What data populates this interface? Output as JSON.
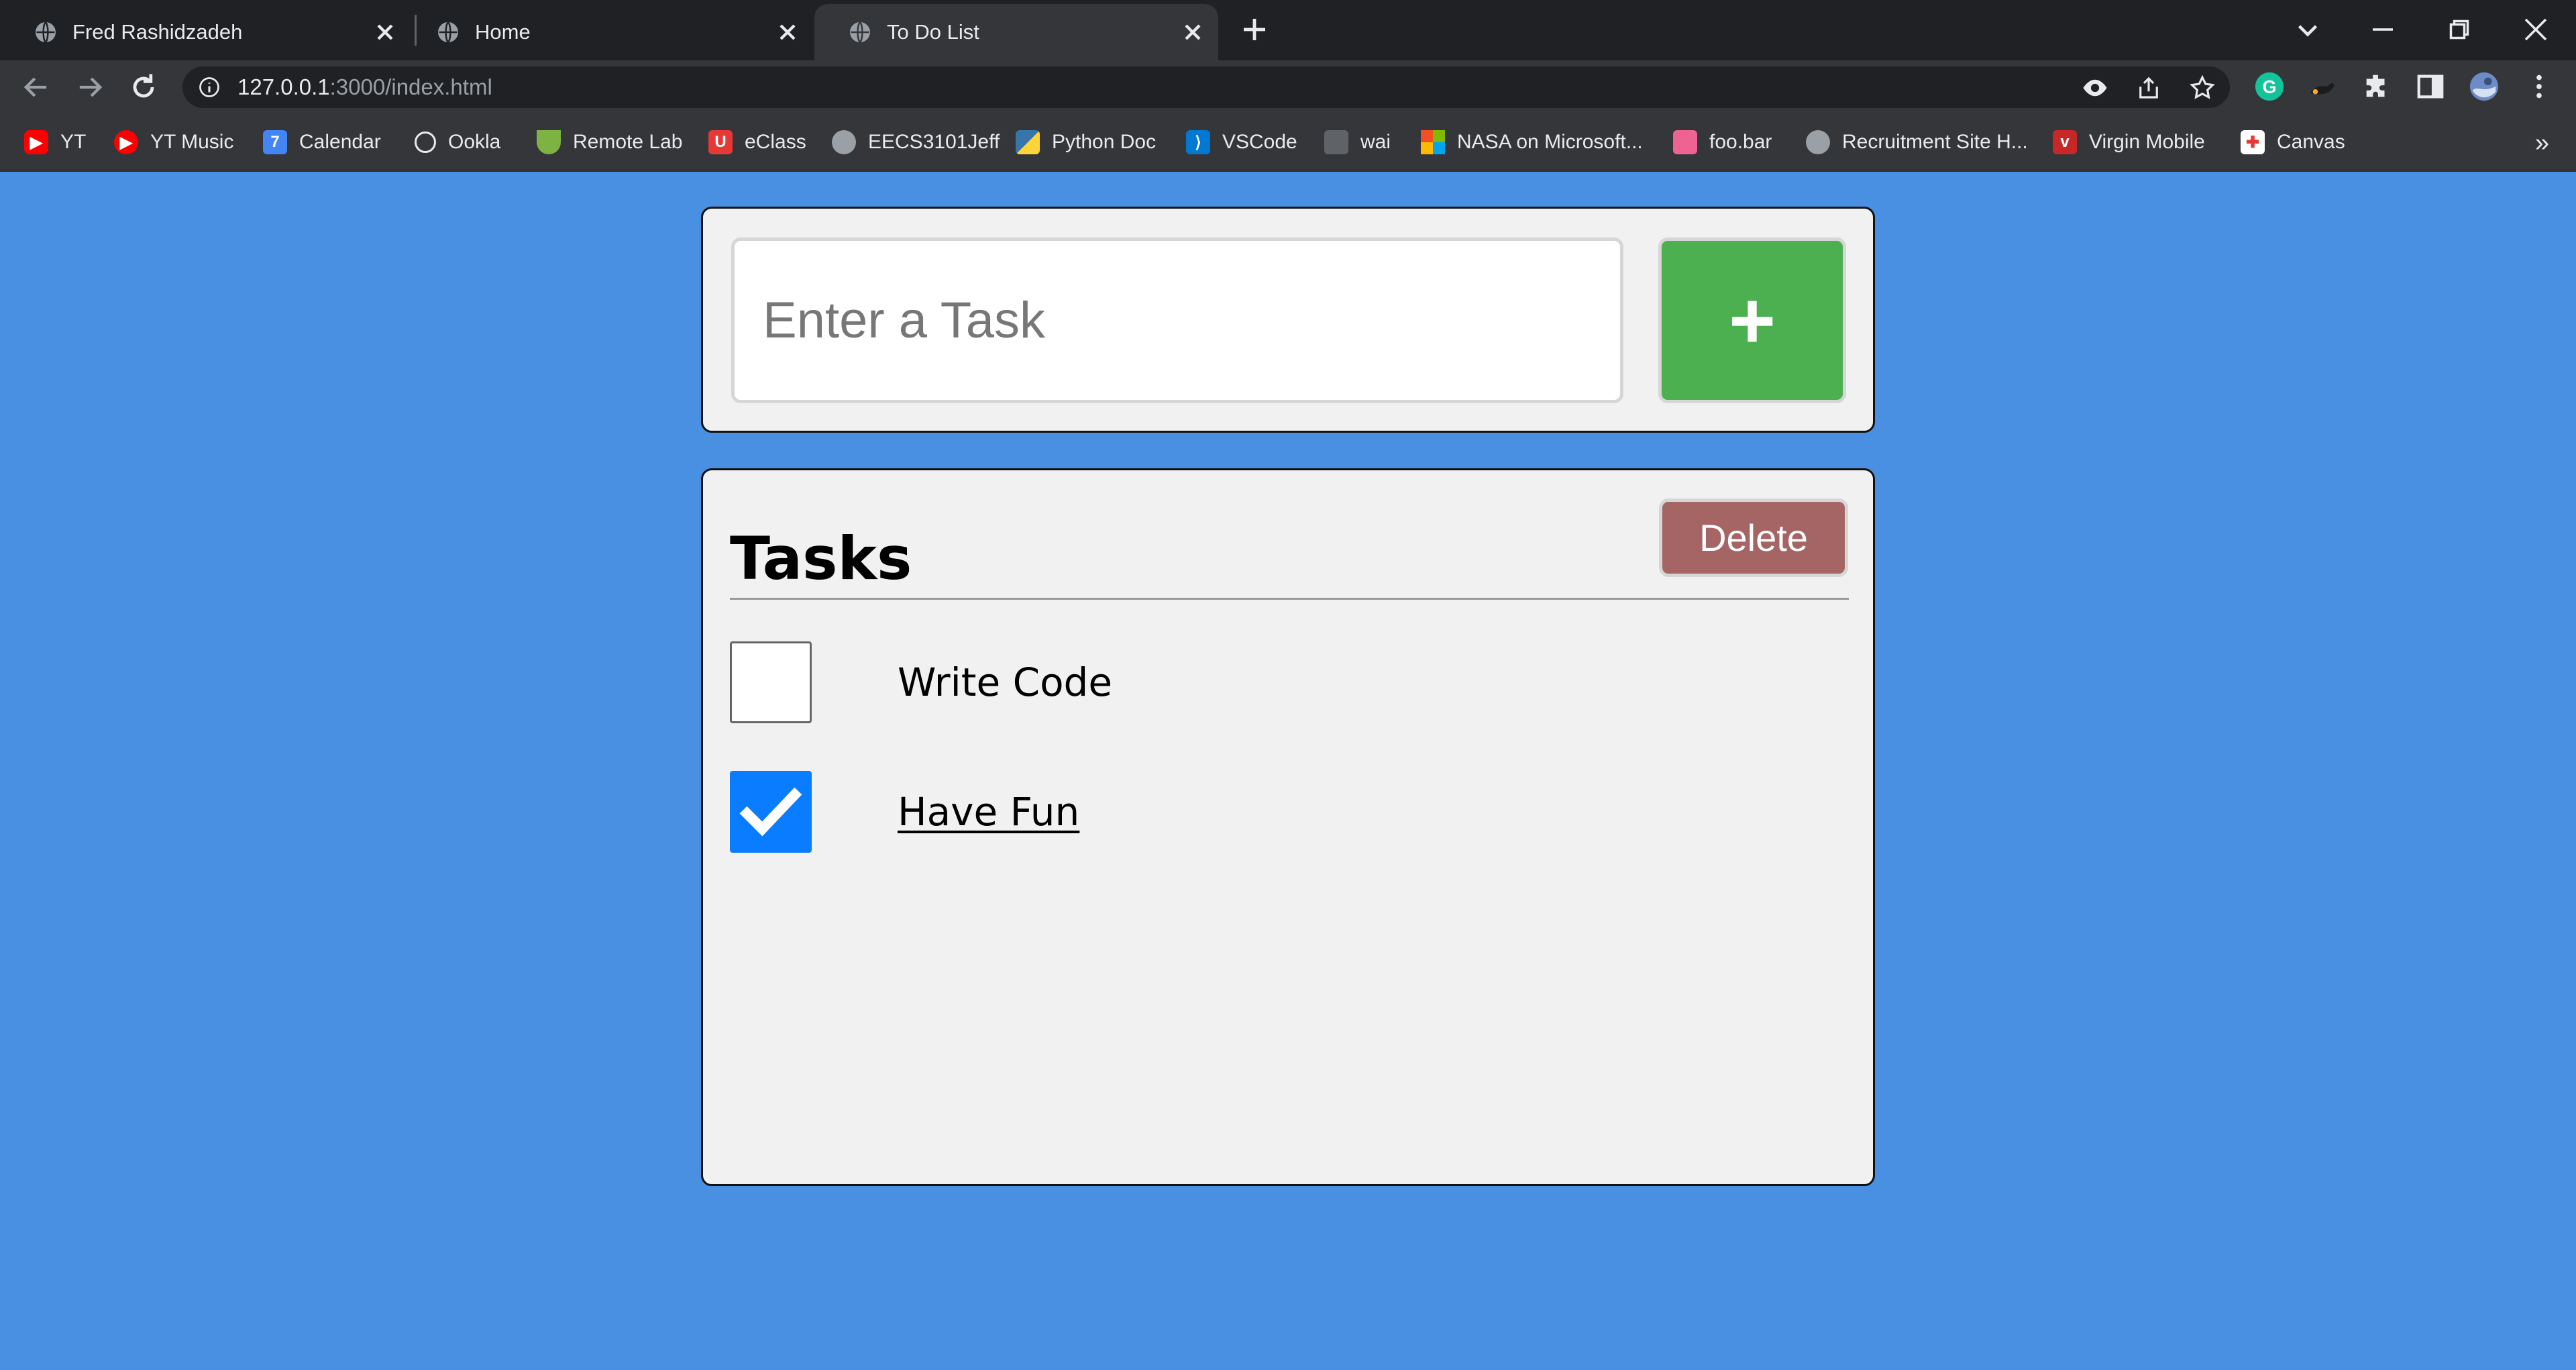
{
  "browser": {
    "tabs": [
      {
        "title": "Fred Rashidzadeh",
        "favicon": "globe-icon",
        "active": false
      },
      {
        "title": "Home",
        "favicon": "globe-icon",
        "active": false
      },
      {
        "title": "To Do List",
        "favicon": "globe-icon",
        "active": true
      }
    ],
    "url_host": "127.0.0.1",
    "url_path": ":3000/index.html",
    "bookmarks": [
      {
        "label": "YT",
        "icon": "youtube-icon",
        "color": "#ff0000"
      },
      {
        "label": "YT Music",
        "icon": "youtube-music-icon",
        "color": "#ff0000"
      },
      {
        "label": "Calendar",
        "icon": "calendar-icon",
        "color": "#4285f4"
      },
      {
        "label": "Ookla",
        "icon": "speedometer-icon",
        "color": "#e8eaed"
      },
      {
        "label": "Remote Lab",
        "icon": "bowl-icon",
        "color": "#7cb342"
      },
      {
        "label": "eClass",
        "icon": "u-logo-icon",
        "color": "#e53935"
      },
      {
        "label": "EECS3101Jeff",
        "icon": "globe-icon",
        "color": "#9aa0a6"
      },
      {
        "label": "Python Doc",
        "icon": "python-icon",
        "color": "#3776ab"
      },
      {
        "label": "VSCode",
        "icon": "vscode-icon",
        "color": "#0078d4"
      },
      {
        "label": "wai",
        "icon": "wai-icon",
        "color": "#5f6368"
      },
      {
        "label": "NASA on Microsoft...",
        "icon": "microsoft-icon",
        "color": "#f25022"
      },
      {
        "label": "foo.bar",
        "icon": "foobar-icon",
        "color": "#f06292"
      },
      {
        "label": "Recruitment Site H...",
        "icon": "globe-icon",
        "color": "#9aa0a6"
      },
      {
        "label": "Virgin Mobile",
        "icon": "virgin-icon",
        "color": "#c62828"
      },
      {
        "label": "Canvas",
        "icon": "canvas-icon",
        "color": "#e53935"
      }
    ],
    "bookmarks_more": "»"
  },
  "app": {
    "input_placeholder": "Enter a Task",
    "input_value": "",
    "add_button_label": "+",
    "add_button_color": "#4caf50",
    "list_title": "Tasks",
    "delete_button_label": "Delete",
    "delete_button_color": "#a66565",
    "tasks": [
      {
        "label": "Write Code",
        "checked": false
      },
      {
        "label": "Have Fun",
        "checked": true
      }
    ],
    "page_background": "#4a90e2",
    "checkbox_checked_color": "#0a7cff"
  }
}
